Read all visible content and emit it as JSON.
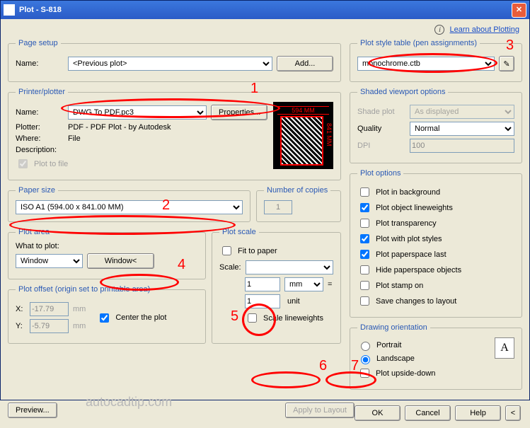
{
  "window": {
    "title": "Plot - S-818"
  },
  "learn": {
    "link": "Learn about Plotting"
  },
  "pagesetup": {
    "legend": "Page setup",
    "name_label": "Name:",
    "name_value": "<Previous plot>",
    "add_btn": "Add..."
  },
  "printer": {
    "legend": "Printer/plotter",
    "name_label": "Name:",
    "name_value": "DWG To PDF.pc3",
    "properties_btn": "Properties...",
    "plotter_label": "Plotter:",
    "plotter_value": "PDF - PDF Plot - by Autodesk",
    "where_label": "Where:",
    "where_value": "File",
    "desc_label": "Description:",
    "plot_to_file": "Plot to file",
    "preview_top": "594 MM",
    "preview_side": "841 MM"
  },
  "papersize": {
    "legend": "Paper size",
    "value": "ISO A1 (594.00 x 841.00 MM)"
  },
  "copies": {
    "legend": "Number of copies",
    "value": "1"
  },
  "plotarea": {
    "legend": "Plot area",
    "what_label": "What to plot:",
    "what_value": "Window",
    "window_btn": "Window<"
  },
  "plotoffset": {
    "legend": "Plot offset (origin set to printable area)",
    "x_label": "X:",
    "x_value": "-17.79",
    "x_unit": "mm",
    "y_label": "Y:",
    "y_value": "-5.79",
    "y_unit": "mm",
    "center": "Center the plot"
  },
  "plotscale": {
    "legend": "Plot scale",
    "fit": "Fit to paper",
    "scale_label": "Scale:",
    "scale_value": "",
    "mm_value": "1",
    "mm_unit": "mm",
    "eq": "=",
    "unit_value": "1",
    "unit_unit": "unit",
    "linew": "Scale lineweights"
  },
  "styletable": {
    "legend": "Plot style table (pen assignments)",
    "value": "monochrome.ctb"
  },
  "shaded": {
    "legend": "Shaded viewport options",
    "shade_label": "Shade plot",
    "shade_value": "As displayed",
    "quality_label": "Quality",
    "quality_value": "Normal",
    "dpi_label": "DPI",
    "dpi_value": "100"
  },
  "plotoptions": {
    "legend": "Plot options",
    "bg": "Plot in background",
    "linew": "Plot object lineweights",
    "trans": "Plot transparency",
    "styles": "Plot with plot styles",
    "ps_last": "Plot paperspace last",
    "hide_ps": "Hide paperspace objects",
    "stamp": "Plot stamp on",
    "save": "Save changes to layout"
  },
  "orient": {
    "legend": "Drawing orientation",
    "portrait": "Portrait",
    "landscape": "Landscape",
    "upside": "Plot upside-down"
  },
  "bottom": {
    "preview": "Preview...",
    "apply": "Apply to Layout",
    "ok": "OK",
    "cancel": "Cancel",
    "help": "Help"
  },
  "watermark": "autocadtip.com",
  "annot": {
    "n1": "1",
    "n2": "2",
    "n3": "3",
    "n4": "4",
    "n5": "5",
    "n6": "6",
    "n7": "7"
  }
}
